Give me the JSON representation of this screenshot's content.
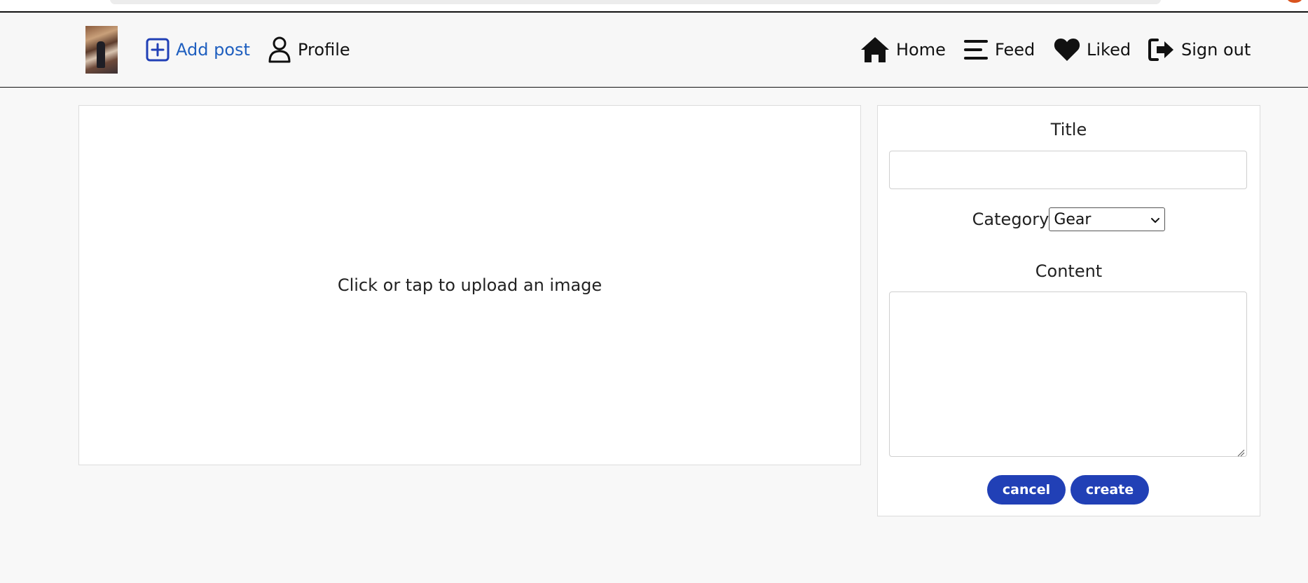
{
  "nav": {
    "add_post": "Add post",
    "profile": "Profile",
    "home": "Home",
    "feed": "Feed",
    "liked": "Liked",
    "sign_out": "Sign out"
  },
  "upload": {
    "prompt": "Click or tap to upload an image"
  },
  "form": {
    "title_label": "Title",
    "title_value": "",
    "category_label": "Category",
    "category_selected": "Gear",
    "content_label": "Content",
    "content_value": "",
    "cancel_label": "cancel",
    "create_label": "create"
  },
  "colors": {
    "accent": "#2140b6",
    "active_link": "#1f5fbf",
    "background": "#f8f8f8"
  },
  "icons": {
    "add_post": "plus-square-icon",
    "profile": "user-icon",
    "home": "home-icon",
    "feed": "menu-lines-icon",
    "liked": "heart-icon",
    "sign_out": "sign-out-icon"
  }
}
